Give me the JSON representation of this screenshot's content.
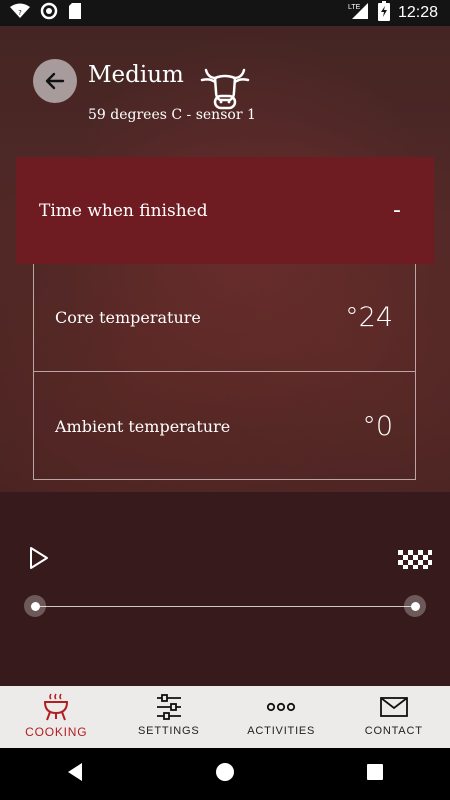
{
  "status_bar": {
    "time": "12:28",
    "network": "LTE",
    "icons": [
      "wifi-icon",
      "sync-icon",
      "sd-card-icon",
      "signal-icon",
      "battery-charging-icon"
    ]
  },
  "header": {
    "title": "Medium",
    "subtitle": "59 degrees C - sensor 1",
    "animal_icon": "cow-icon"
  },
  "finish_panel": {
    "label": "Time when finished",
    "value": "-"
  },
  "temperatures": [
    {
      "label": "Core temperature",
      "value": "°24"
    },
    {
      "label": "Ambient temperature",
      "value": "°0"
    }
  ],
  "player": {
    "play_icon": "play-icon",
    "finish_icon": "checkered-flag-icon",
    "progress_fraction": 0
  },
  "bottom_nav": [
    {
      "label": "COOKING",
      "icon": "grill-icon",
      "active": true
    },
    {
      "label": "SETTINGS",
      "icon": "sliders-icon",
      "active": false
    },
    {
      "label": "ACTIVITIES",
      "icon": "dots-icon",
      "active": false
    },
    {
      "label": "CONTACT",
      "icon": "mail-icon",
      "active": false
    }
  ],
  "colors": {
    "accent_red": "#b21e23",
    "panel_red": "#6e1c22",
    "player_bg": "#371a1b",
    "nav_bg": "#ecebe9"
  }
}
